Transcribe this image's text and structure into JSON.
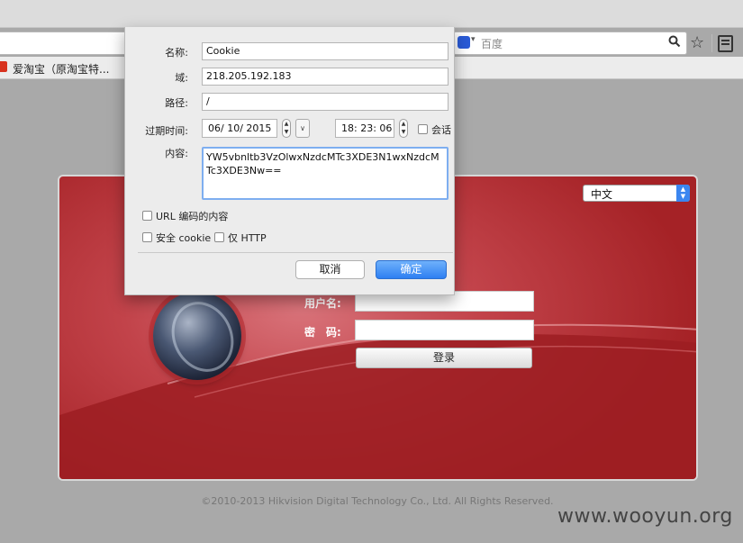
{
  "browser": {
    "search": {
      "placeholder": "百度",
      "engine_icon": "baidu-paw-icon"
    },
    "bookmarks": [
      {
        "label": "爱淘宝（原淘宝特..."
      }
    ],
    "icons": {
      "bookmark_star": "star-icon",
      "reader": "reader-list-icon",
      "search": "search-icon"
    }
  },
  "cookie_dialog": {
    "name_label": "名称:",
    "name_value": "Cookie",
    "domain_label": "域:",
    "domain_value": "218.205.192.183",
    "path_label": "路径:",
    "path_value": "/",
    "expires_label": "过期时间:",
    "expires_date": "06/ 10/  2015",
    "expires_time": "18: 23: 06",
    "session_label": "会话",
    "session_checked": false,
    "content_label": "内容:",
    "content_value": "YW5vbnltb3VzOlwxNzdcMTc3XDE3N1wxNzdcMTc3XDE3Nw==",
    "url_encoded_label": "URL 编码的内容",
    "url_encoded_checked": false,
    "secure_label": "安全 cookie",
    "secure_checked": false,
    "http_only_label": "仅 HTTP",
    "http_only_checked": false,
    "cancel_label": "取消",
    "ok_label": "确定"
  },
  "login_page": {
    "language": "中文",
    "username_label": "用户名:",
    "password_label": "密　码:",
    "login_button": "登录",
    "copyright": "©2010-2013 Hikvision Digital Technology Co., Ltd. All Rights Reserved."
  },
  "watermark": "www.wooyun.org",
  "colors": {
    "accent_blue": "#3b86f0",
    "panel_red": "#b8353b",
    "ok_button": "#2d7ff2"
  }
}
